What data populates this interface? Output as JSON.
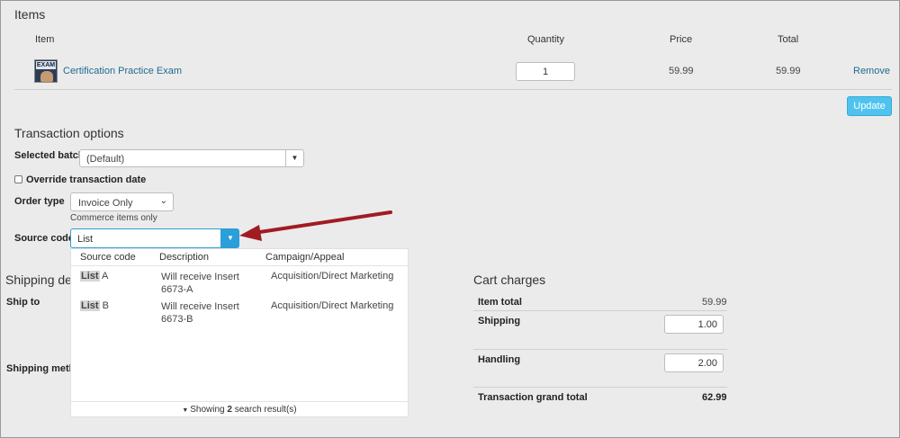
{
  "items_section": {
    "title": "Items",
    "col_item": "Item",
    "col_quantity": "Quantity",
    "col_price": "Price",
    "col_total": "Total",
    "row": {
      "thumb_text": "EXAM",
      "name": "Certification Practice Exam",
      "quantity": "1",
      "price": "59.99",
      "total": "59.99",
      "remove": "Remove"
    },
    "update_label": "Update"
  },
  "transaction": {
    "title": "Transaction options",
    "batch_label": "Selected batch",
    "batch_value": "(Default)",
    "override_label": "Override transaction date",
    "order_type_label": "Order type",
    "order_type_value": "Invoice Only",
    "order_type_hint": "Commerce items only",
    "source_code_label": "Source code",
    "source_code_value": "List"
  },
  "dropdown": {
    "headers": [
      "Source code",
      "Description",
      "Campaign/Appeal"
    ],
    "rows": [
      {
        "code_match": "List",
        "code_rest": " A",
        "description": "Will receive Insert 6673-A",
        "campaign": "Acquisition/Direct Marketing"
      },
      {
        "code_match": "List",
        "code_rest": " B",
        "description": "Will receive Insert 6673-B",
        "campaign": "Acquisition/Direct Marketing"
      }
    ],
    "footer_prefix": "Showing ",
    "footer_count": "2",
    "footer_suffix": " search result(s)"
  },
  "shipping": {
    "title": "Shipping det",
    "ship_to_label": "Ship to",
    "method_label": "Shipping metho"
  },
  "cart": {
    "title": "Cart charges",
    "item_total_label": "Item total",
    "item_total_value": "59.99",
    "shipping_label": "Shipping",
    "shipping_value": "1.00",
    "handling_label": "Handling",
    "handling_value": "2.00",
    "grand_total_label": "Transaction grand total",
    "grand_total_value": "62.99"
  },
  "colors": {
    "accent": "#4fc3ef",
    "dropdown_button": "#2a9fd8",
    "arrow": "#a01c22",
    "link": "#1f6b8f"
  }
}
